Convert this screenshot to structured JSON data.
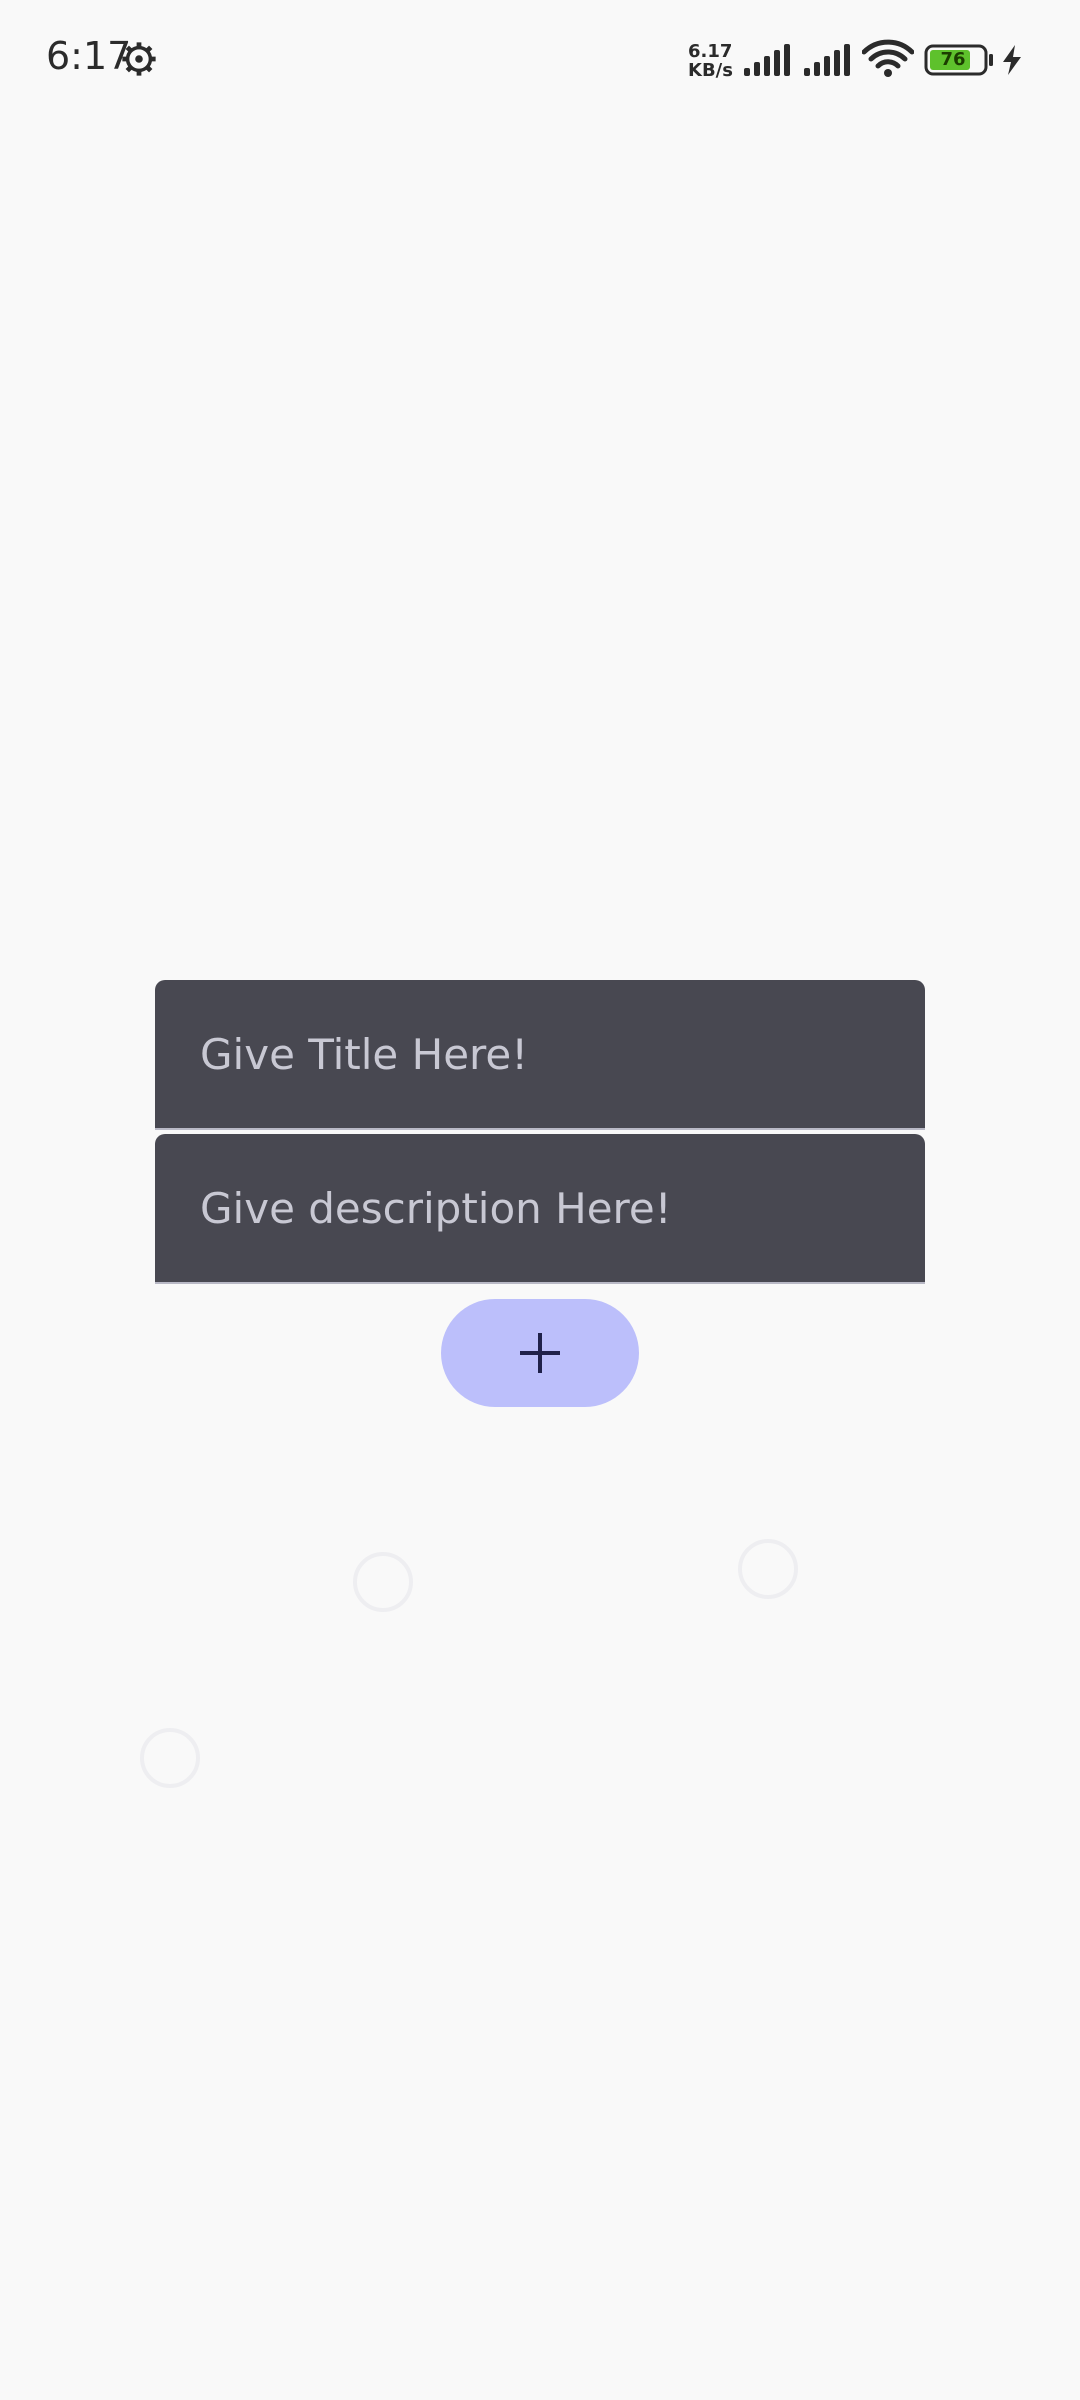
{
  "status_bar": {
    "time": "6:17",
    "net_speed_value": "6.17",
    "net_speed_unit": "KB/s",
    "battery_level": "76",
    "icons": [
      "gear-icon",
      "signal-icon",
      "signal-icon",
      "wifi-icon",
      "battery-icon",
      "charging-bolt-icon"
    ]
  },
  "form": {
    "title_placeholder": "Give Title Here!",
    "description_placeholder": "Give description Here!",
    "add_button_icon": "plus-icon"
  },
  "colors": {
    "background": "#f9f9f9",
    "field_background": "#484851",
    "field_text": "#c8c8d3",
    "button_background": "#bcbffb",
    "button_icon": "#20214a",
    "battery_fill": "#5ec12c"
  }
}
